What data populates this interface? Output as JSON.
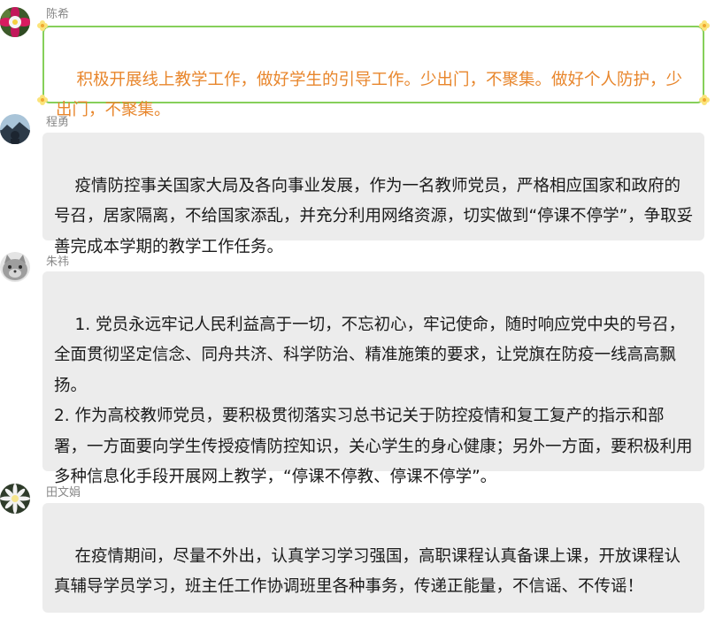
{
  "chat": {
    "messages": [
      {
        "sender": "陈希",
        "avatar_icon": "columbine-flower-avatar-icon",
        "text": "积极开展线上教学工作，做好学生的引导工作。少出门，不聚集。做好个人防护，少出门，不聚集。",
        "bubble_style": "flower-frame",
        "text_color": "#e8862c",
        "border_color": "#86cf5a"
      },
      {
        "sender": "程勇",
        "avatar_icon": "landscape-photo-avatar-icon",
        "text": "疫情防控事关国家大局及各向事业发展，作为一名教师党员，严格相应国家和政府的号召，居家隔离，不给国家添乱，并充分利用网络资源，切实做到“停课不停学”，争取妥善完成本学期的教学工作任务。",
        "bubble_style": "plain"
      },
      {
        "sender": "朱祎",
        "avatar_icon": "gray-cartoon-cat-avatar-icon",
        "text": "1. 党员永远牢记人民利益高于一切，不忘初心，牢记使命，随时响应党中央的号召，全面贯彻坚定信念、同舟共济、科学防治、精准施策的要求，让党旗在防疫一线高高飘扬。\n2. 作为高校教师党员，要积极贯彻落实习总书记关于防控疫情和复工复产的指示和部署，一方面要向学生传授疫情防控知识，关心学生的身心健康；另外一方面，要积极利用多种信息化手段开展网上教学，“停课不停教、停课不停学”。",
        "bubble_style": "plain"
      },
      {
        "sender": "田文娟",
        "avatar_icon": "white-flower-avatar-icon",
        "text": "在疫情期间，尽量不外出，认真学习学习强国，高职课程认真备课上课，开放课程认真辅导学员学习，班主任工作协调班里各种事务，传递正能量，不信谣、不传谣！",
        "bubble_style": "plain"
      }
    ]
  }
}
